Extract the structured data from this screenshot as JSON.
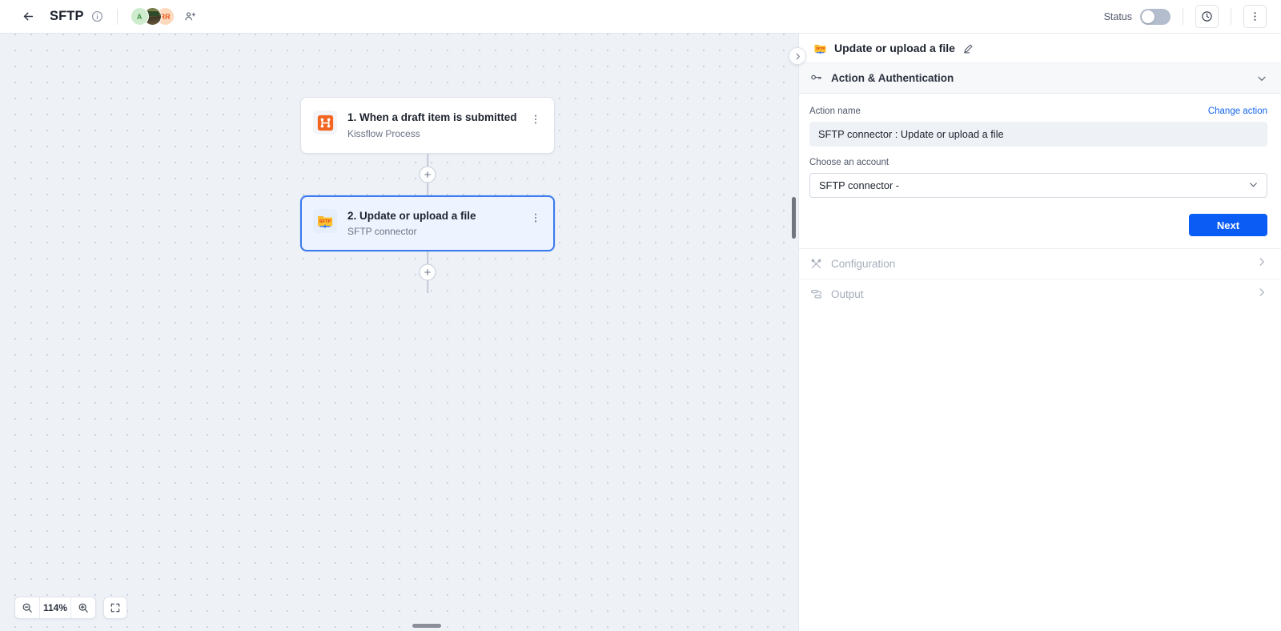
{
  "topbar": {
    "back_icon": "arrow-left-icon",
    "title": "SFTP",
    "info_icon": "info-circle-icon",
    "avatars": [
      {
        "initials": "A",
        "type": "initials"
      },
      {
        "initials": "",
        "type": "photo"
      },
      {
        "initials": "RR",
        "type": "initials"
      }
    ],
    "add_person_icon": "add-person-icon",
    "status_label": "Status",
    "status_on": false,
    "history_icon": "clock-icon",
    "more_icon": "more-vertical-icon"
  },
  "canvas": {
    "collapse_icon": "chevron-right-icon",
    "nodes": [
      {
        "icon": "kissflow-process-icon",
        "title": "1. When a draft item is submitted",
        "subtitle": "Kissflow Process",
        "menu_icon": "more-vertical-icon",
        "selected": false
      },
      {
        "icon": "sftp-connector-icon",
        "title": "2. Update or upload a file",
        "subtitle": "SFTP connector",
        "menu_icon": "more-vertical-icon",
        "selected": true
      }
    ],
    "add_step_icon": "plus-icon",
    "zoom": {
      "zoom_out_icon": "zoom-out-icon",
      "level": "114%",
      "zoom_in_icon": "zoom-in-icon",
      "fit_icon": "fit-to-screen-icon"
    }
  },
  "panel": {
    "header": {
      "icon": "sftp-connector-icon",
      "title": "Update or upload a file",
      "edit_icon": "pencil-icon"
    },
    "section": {
      "icon": "key-icon",
      "label": "Action & Authentication",
      "chevron_icon": "chevron-down-icon",
      "expanded": true,
      "action_name_label": "Action name",
      "change_action_link": "Change action",
      "action_name_value": "SFTP connector : Update or upload a file",
      "account_label": "Choose an account",
      "account_value": "SFTP connector -",
      "account_chevron_icon": "chevron-down-icon",
      "next_button": "Next"
    },
    "collapsed_sections": [
      {
        "icon": "tools-icon",
        "label": "Configuration",
        "chevron_icon": "chevron-right-icon"
      },
      {
        "icon": "output-flow-icon",
        "label": "Output",
        "chevron_icon": "chevron-right-icon"
      }
    ]
  },
  "colors": {
    "accent_blue": "#0a5cf5",
    "link_blue": "#1565f0",
    "selected_node_border": "#3b7bef",
    "selected_node_bg": "#eef4ff",
    "canvas_bg": "#eef1f6",
    "kissflow_orange": "#f26622",
    "sftp_yellow": "#f5b324"
  }
}
